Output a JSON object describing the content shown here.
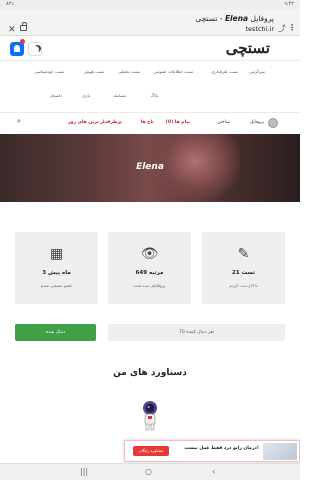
{
  "status": {
    "time": "۹:۴۲",
    "battery": "۸۳٪"
  },
  "browser": {
    "title_prefix": "پروفایل ",
    "title_name": "Elena",
    "title_suffix": " - تستچی",
    "url": "testchi.ir"
  },
  "site": {
    "logo": "تستچی"
  },
  "nav_row1": [
    "تست خودشناسی",
    "تست هوش",
    "تست تحلیلی",
    "تست اطلاعات عمومی",
    "تست طرفداری",
    "سرگرمی"
  ],
  "nav_row2": [
    "داستان",
    "بازی",
    "مسابقه",
    "بلاگ"
  ],
  "nav_row3": {
    "profile": "پروفایل",
    "buildtest": "ساختن",
    "messages": "پیام ها (0)",
    "coins": "تاج ها",
    "popular": "پرطرفدار ترین های روز"
  },
  "hero": {
    "name": "Elena"
  },
  "stats": [
    {
      "icon": "pencil-icon",
      "value": "21 تست",
      "sub": "تا الان ثبت کردم"
    },
    {
      "icon": "eye-icon",
      "value": "649 مرتبه",
      "sub": "پروفایلم دیده شده"
    },
    {
      "icon": "calendar-icon",
      "value": "3 ماه پیش",
      "sub": "عضو تستچی شدم"
    }
  ],
  "buttons": {
    "followers": "70 نفر دنبال کننده",
    "follow": "دنبال شده"
  },
  "achievements": {
    "title": "دستاورد های من"
  },
  "promo": {
    "text": "درمان زانو درد فقط عمل نیست!",
    "button": "مشاوره رایگان"
  }
}
